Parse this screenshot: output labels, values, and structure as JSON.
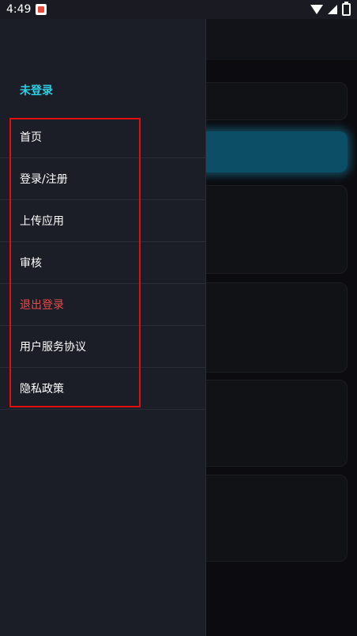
{
  "status_bar": {
    "time": "4:49",
    "icons": [
      "app-notification-icon",
      "wifi-icon",
      "cellular-signal-icon",
      "battery-icon"
    ]
  },
  "drawer": {
    "title": "未登录",
    "items": [
      {
        "label": "首页"
      },
      {
        "label": "登录/注册"
      },
      {
        "label": "上传应用"
      },
      {
        "label": "审核"
      },
      {
        "label": "退出登录",
        "color": "#e64b4b"
      },
      {
        "label": "用户服务协议"
      },
      {
        "label": "隐私政策"
      }
    ]
  },
  "colors": {
    "accent": "#2ad0e3",
    "danger": "#e64b4b",
    "highlight_box": "#e01010",
    "drawer_bg": "#1c1e27"
  }
}
